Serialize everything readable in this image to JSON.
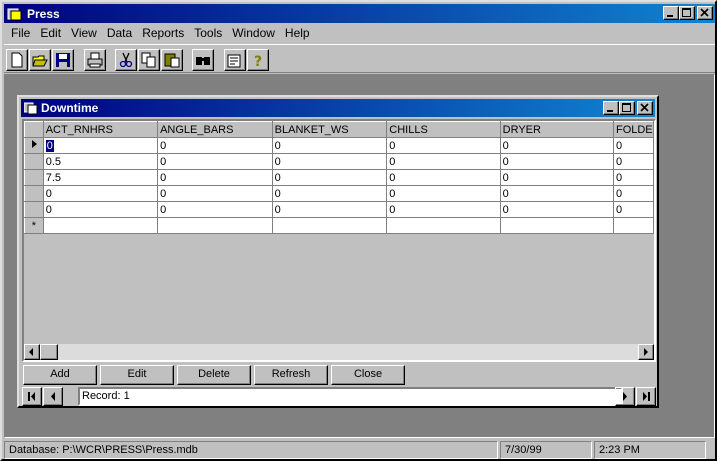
{
  "app": {
    "title": "Press"
  },
  "menu": [
    "File",
    "Edit",
    "View",
    "Data",
    "Reports",
    "Tools",
    "Window",
    "Help"
  ],
  "toolbar": {
    "icons": [
      "new-icon",
      "open-icon",
      "save-icon",
      "print-icon",
      "cut-icon",
      "copy-icon",
      "paste-icon",
      "find-icon",
      "properties-icon",
      "help-icon"
    ]
  },
  "child": {
    "title": "Downtime",
    "grid": {
      "columns": [
        "ACT_RNHRS",
        "ANGLE_BARS",
        "BLANKET_WS",
        "CHILLS",
        "DRYER",
        "FOLDE"
      ],
      "rows": [
        [
          "0",
          "0",
          "0",
          "0",
          "0",
          "0"
        ],
        [
          "0.5",
          "0",
          "0",
          "0",
          "0",
          "0"
        ],
        [
          "7.5",
          "0",
          "0",
          "0",
          "0",
          "0"
        ],
        [
          "0",
          "0",
          "0",
          "0",
          "0",
          "0"
        ],
        [
          "0",
          "0",
          "0",
          "0",
          "0",
          "0"
        ]
      ],
      "new_row_marker": "*"
    },
    "buttons": {
      "add": "Add",
      "edit": "Edit",
      "delete": "Delete",
      "refresh": "Refresh",
      "close": "Close"
    },
    "record_label": "Record: 1"
  },
  "status": {
    "database": "Database:  P:\\WCR\\PRESS\\Press.mdb",
    "date": "7/30/99",
    "time": "2:23 PM"
  },
  "colors": {
    "titlebar": "#000080",
    "face": "#c0c0c0",
    "mdi_background": "#808080"
  }
}
